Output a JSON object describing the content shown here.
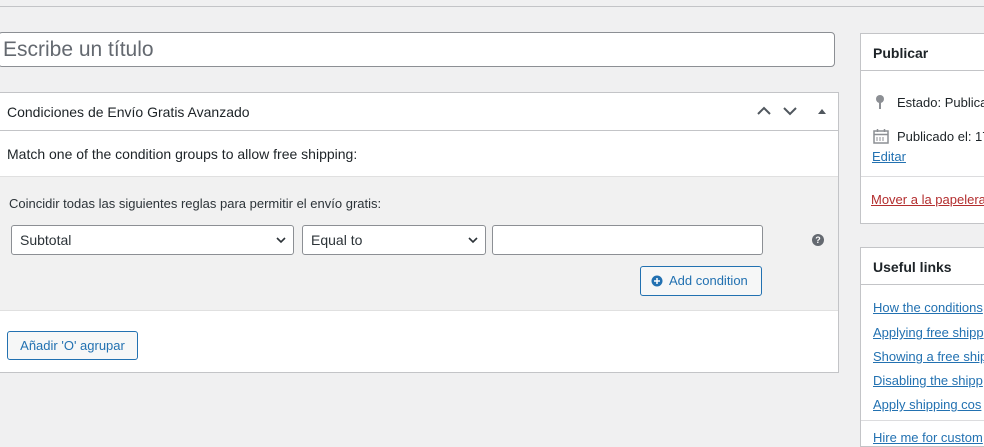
{
  "title_input": {
    "placeholder": "Escribe un título"
  },
  "main_box": {
    "title": "Condiciones de Envío Gratis Avanzado",
    "description": "Match one of the condition groups to allow free shipping:",
    "group": {
      "label": "Coincidir todas las siguientes reglas para permitir el envío gratis:",
      "condition_select": "Subtotal",
      "operator_select": "Equal to",
      "value": "",
      "help_glyph": "?",
      "add_condition_label": "Add condition"
    },
    "or_group_label": "Añadir 'O' agrupar"
  },
  "publish_box": {
    "title": "Publicar",
    "status": "Estado: Publica",
    "published": "Publicado el: 17",
    "edit_link": "Editar",
    "trash_link": "Mover a la papelera"
  },
  "links_box": {
    "title": "Useful links",
    "links": [
      "How the conditions",
      "Applying free shipp",
      "Showing a free ship",
      "Disabling the shipp",
      "Apply shipping cos",
      "Hire me for custom"
    ]
  },
  "icons": [
    "chevron-up-icon",
    "chevron-down-icon",
    "toggle-arrow-icon",
    "pin-icon",
    "calendar-icon",
    "plus-circle-icon",
    "help-icon"
  ]
}
